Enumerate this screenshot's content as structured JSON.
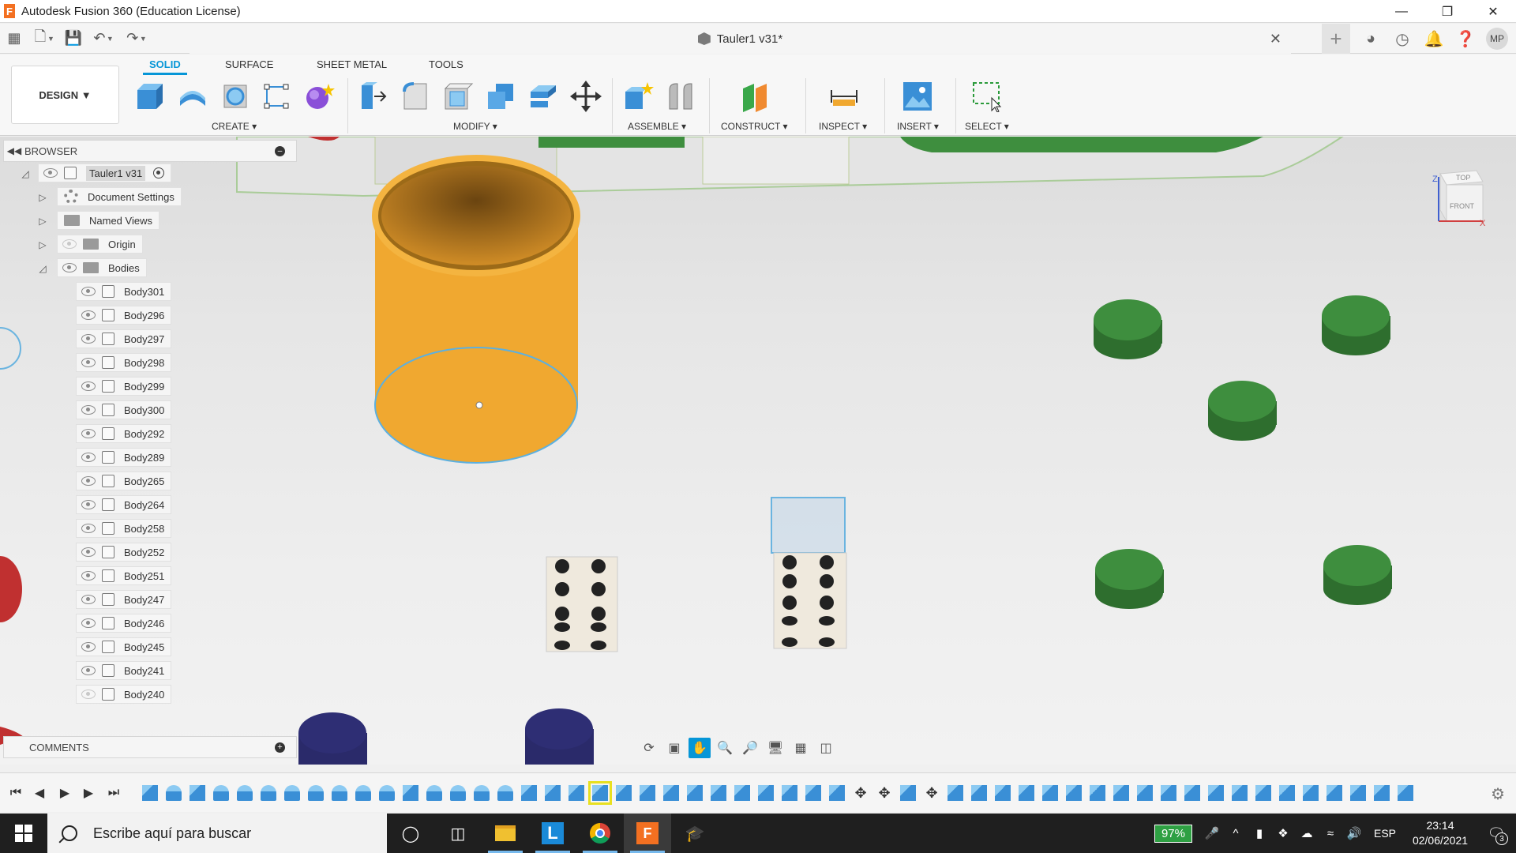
{
  "window": {
    "title": "Autodesk Fusion 360 (Education License)",
    "app_logo": "F"
  },
  "topbar": {
    "document_title": "Tauler1 v31*",
    "user_initials": "MP"
  },
  "ribbon": {
    "workspace": "DESIGN",
    "tabs": [
      "SOLID",
      "SURFACE",
      "SHEET METAL",
      "TOOLS"
    ],
    "active_tab": "SOLID",
    "groups": [
      "CREATE",
      "MODIFY",
      "ASSEMBLE",
      "CONSTRUCT",
      "INSPECT",
      "INSERT",
      "SELECT"
    ]
  },
  "browser": {
    "title": "BROWSER",
    "root": "Tauler1 v31",
    "items": [
      {
        "label": "Document Settings",
        "icon": "gear-icon"
      },
      {
        "label": "Named Views",
        "icon": "folder-icon"
      },
      {
        "label": "Origin",
        "icon": "folder-icon"
      },
      {
        "label": "Bodies",
        "icon": "folder-icon"
      }
    ],
    "bodies": [
      {
        "name": "Body301",
        "visible": true
      },
      {
        "name": "Body296",
        "visible": true
      },
      {
        "name": "Body297",
        "visible": true
      },
      {
        "name": "Body298",
        "visible": true
      },
      {
        "name": "Body299",
        "visible": true
      },
      {
        "name": "Body300",
        "visible": true
      },
      {
        "name": "Body292",
        "visible": true
      },
      {
        "name": "Body289",
        "visible": true
      },
      {
        "name": "Body265",
        "visible": true
      },
      {
        "name": "Body264",
        "visible": true
      },
      {
        "name": "Body258",
        "visible": true
      },
      {
        "name": "Body252",
        "visible": true
      },
      {
        "name": "Body251",
        "visible": true
      },
      {
        "name": "Body247",
        "visible": true
      },
      {
        "name": "Body246",
        "visible": true
      },
      {
        "name": "Body245",
        "visible": true
      },
      {
        "name": "Body241",
        "visible": true
      },
      {
        "name": "Body240",
        "visible": false
      }
    ]
  },
  "comments": {
    "title": "COMMENTS"
  },
  "viewcube": {
    "top": "TOP",
    "front": "FRONT",
    "axis_z": "Z",
    "axis_x": "X"
  },
  "taskbar": {
    "search_placeholder": "Escribe aquí para buscar",
    "battery": "97%",
    "language": "ESP",
    "time": "23:14",
    "date": "02/06/2021",
    "notifications": "3"
  },
  "colors": {
    "accent": "#0696d7",
    "cylinder": "#f0a830",
    "green_piece": "#3e8e3e",
    "navy_piece": "#2a2a6a"
  }
}
